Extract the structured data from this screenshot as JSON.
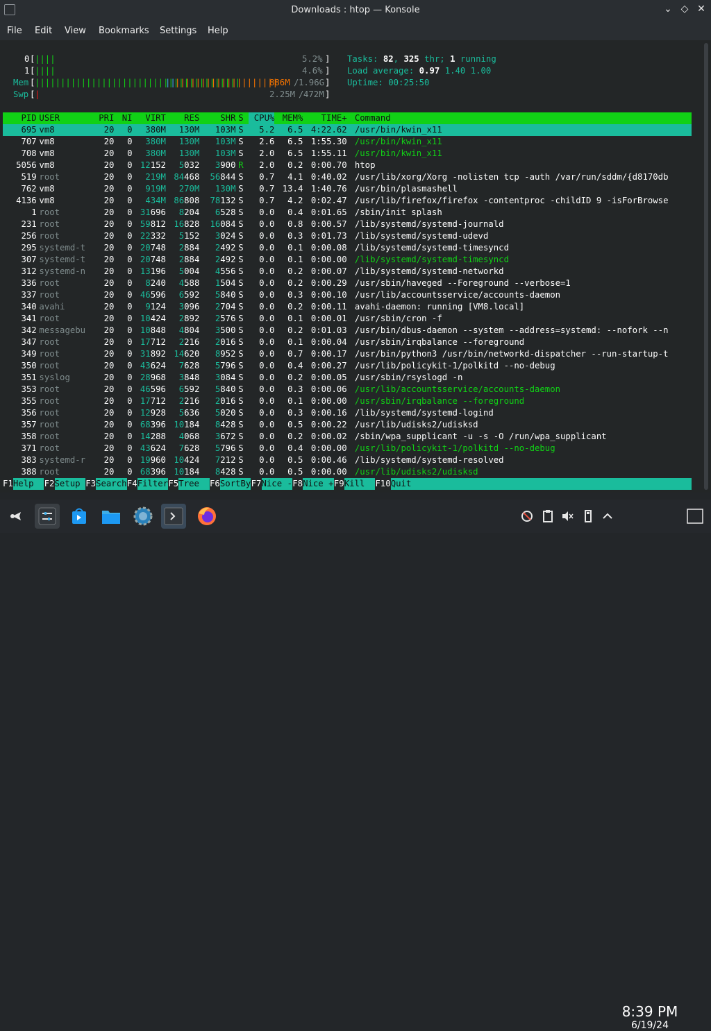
{
  "window": {
    "title": "Downloads : htop — Konsole"
  },
  "menu": [
    "File",
    "Edit",
    "View",
    "Bookmarks",
    "Settings",
    "Help"
  ],
  "meters": {
    "cpu0": {
      "label": "0",
      "bar": "||||",
      "value": "5.2%"
    },
    "cpu1": {
      "label": "1",
      "bar": "||||",
      "value": "4.6%"
    },
    "mem": {
      "label": "Mem",
      "bar_green": "||||||||||||||||||||||||||||||||||||||||",
      "bar_blue": "||",
      "bar_orange": "||||||||||||||||||||",
      "used": "886M",
      "total": "1.96G"
    },
    "swp": {
      "label": "Swp",
      "bar": "|",
      "used": "2.25M",
      "total": "472M"
    }
  },
  "stats": {
    "tasks": "82",
    "thr": "325",
    "running": "1",
    "load1": "0.97",
    "load5": "1.40",
    "load15": "1.00",
    "uptime": "00:25:50"
  },
  "table": {
    "columns": [
      "PID",
      "USER",
      "PRI",
      "NI",
      "VIRT",
      "RES",
      "SHR",
      "S",
      "CPU%",
      "MEM%",
      "TIME+",
      "Command"
    ],
    "sort_column": "CPU%",
    "rows": [
      {
        "pid": "695",
        "user": "vm8",
        "pri": "20",
        "ni": "0",
        "virt": "380M",
        "res": "130M",
        "shr": "103M",
        "s": "S",
        "cpu": "5.2",
        "mem": "6.5",
        "time": "4:22.62",
        "cmd": "/usr/bin/kwin_x11",
        "selected": true
      },
      {
        "pid": "707",
        "user": "vm8",
        "pri": "20",
        "ni": "0",
        "virt": "380M",
        "res": "130M",
        "shr": "103M",
        "s": "S",
        "cpu": "2.6",
        "mem": "6.5",
        "time": "1:55.30",
        "cmd": "/usr/bin/kwin_x11",
        "thread": true
      },
      {
        "pid": "708",
        "user": "vm8",
        "pri": "20",
        "ni": "0",
        "virt": "380M",
        "res": "130M",
        "shr": "103M",
        "s": "S",
        "cpu": "2.0",
        "mem": "6.5",
        "time": "1:55.11",
        "cmd": "/usr/bin/kwin_x11",
        "thread": true
      },
      {
        "pid": "5056",
        "user": "vm8",
        "pri": "20",
        "ni": "0",
        "virt": "12152",
        "res": "5032",
        "shr": "3900",
        "s": "R",
        "cpu": "2.0",
        "mem": "0.2",
        "time": "0:00.70",
        "cmd": "htop"
      },
      {
        "pid": "519",
        "user": "root",
        "pri": "20",
        "ni": "0",
        "virt": "219M",
        "res": "84468",
        "shr": "56844",
        "s": "S",
        "cpu": "0.7",
        "mem": "4.1",
        "time": "0:40.02",
        "cmd": "/usr/lib/xorg/Xorg -nolisten tcp -auth /var/run/sddm/{d8170db"
      },
      {
        "pid": "762",
        "user": "vm8",
        "pri": "20",
        "ni": "0",
        "virt": "919M",
        "res": "270M",
        "shr": "130M",
        "s": "S",
        "cpu": "0.7",
        "mem": "13.4",
        "time": "1:40.76",
        "cmd": "/usr/bin/plasmashell"
      },
      {
        "pid": "4136",
        "user": "vm8",
        "pri": "20",
        "ni": "0",
        "virt": "434M",
        "res": "86808",
        "shr": "78132",
        "s": "S",
        "cpu": "0.7",
        "mem": "4.2",
        "time": "0:02.47",
        "cmd": "/usr/lib/firefox/firefox -contentproc -childID 9 -isForBrowse"
      },
      {
        "pid": "1",
        "user": "root",
        "pri": "20",
        "ni": "0",
        "virt": "31696",
        "res": "8204",
        "shr": "6528",
        "s": "S",
        "cpu": "0.0",
        "mem": "0.4",
        "time": "0:01.65",
        "cmd": "/sbin/init splash"
      },
      {
        "pid": "231",
        "user": "root",
        "pri": "20",
        "ni": "0",
        "virt": "59812",
        "res": "16828",
        "shr": "16084",
        "s": "S",
        "cpu": "0.0",
        "mem": "0.8",
        "time": "0:00.57",
        "cmd": "/lib/systemd/systemd-journald"
      },
      {
        "pid": "256",
        "user": "root",
        "pri": "20",
        "ni": "0",
        "virt": "22332",
        "res": "5152",
        "shr": "3024",
        "s": "S",
        "cpu": "0.0",
        "mem": "0.3",
        "time": "0:01.73",
        "cmd": "/lib/systemd/systemd-udevd"
      },
      {
        "pid": "295",
        "user": "systemd-t",
        "pri": "20",
        "ni": "0",
        "virt": "20748",
        "res": "2884",
        "shr": "2492",
        "s": "S",
        "cpu": "0.0",
        "mem": "0.1",
        "time": "0:00.08",
        "cmd": "/lib/systemd/systemd-timesyncd"
      },
      {
        "pid": "307",
        "user": "systemd-t",
        "pri": "20",
        "ni": "0",
        "virt": "20748",
        "res": "2884",
        "shr": "2492",
        "s": "S",
        "cpu": "0.0",
        "mem": "0.1",
        "time": "0:00.00",
        "cmd": "/lib/systemd/systemd-timesyncd",
        "thread": true
      },
      {
        "pid": "312",
        "user": "systemd-n",
        "pri": "20",
        "ni": "0",
        "virt": "13196",
        "res": "5004",
        "shr": "4556",
        "s": "S",
        "cpu": "0.0",
        "mem": "0.2",
        "time": "0:00.07",
        "cmd": "/lib/systemd/systemd-networkd"
      },
      {
        "pid": "336",
        "user": "root",
        "pri": "20",
        "ni": "0",
        "virt": "8240",
        "res": "4588",
        "shr": "1504",
        "s": "S",
        "cpu": "0.0",
        "mem": "0.2",
        "time": "0:00.29",
        "cmd": "/usr/sbin/haveged --Foreground --verbose=1"
      },
      {
        "pid": "337",
        "user": "root",
        "pri": "20",
        "ni": "0",
        "virt": "46596",
        "res": "6592",
        "shr": "5840",
        "s": "S",
        "cpu": "0.0",
        "mem": "0.3",
        "time": "0:00.10",
        "cmd": "/usr/lib/accountsservice/accounts-daemon"
      },
      {
        "pid": "340",
        "user": "avahi",
        "pri": "20",
        "ni": "0",
        "virt": "9124",
        "res": "3096",
        "shr": "2704",
        "s": "S",
        "cpu": "0.0",
        "mem": "0.2",
        "time": "0:00.11",
        "cmd": "avahi-daemon: running [VM8.local]"
      },
      {
        "pid": "341",
        "user": "root",
        "pri": "20",
        "ni": "0",
        "virt": "10424",
        "res": "2892",
        "shr": "2576",
        "s": "S",
        "cpu": "0.0",
        "mem": "0.1",
        "time": "0:00.01",
        "cmd": "/usr/sbin/cron -f"
      },
      {
        "pid": "342",
        "user": "messagebu",
        "pri": "20",
        "ni": "0",
        "virt": "10848",
        "res": "4804",
        "shr": "3500",
        "s": "S",
        "cpu": "0.0",
        "mem": "0.2",
        "time": "0:01.03",
        "cmd": "/usr/bin/dbus-daemon --system --address=systemd: --nofork --n"
      },
      {
        "pid": "347",
        "user": "root",
        "pri": "20",
        "ni": "0",
        "virt": "17712",
        "res": "2216",
        "shr": "2016",
        "s": "S",
        "cpu": "0.0",
        "mem": "0.1",
        "time": "0:00.04",
        "cmd": "/usr/sbin/irqbalance --foreground"
      },
      {
        "pid": "349",
        "user": "root",
        "pri": "20",
        "ni": "0",
        "virt": "31892",
        "res": "14620",
        "shr": "8952",
        "s": "S",
        "cpu": "0.0",
        "mem": "0.7",
        "time": "0:00.17",
        "cmd": "/usr/bin/python3 /usr/bin/networkd-dispatcher --run-startup-t"
      },
      {
        "pid": "350",
        "user": "root",
        "pri": "20",
        "ni": "0",
        "virt": "43624",
        "res": "7628",
        "shr": "5796",
        "s": "S",
        "cpu": "0.0",
        "mem": "0.4",
        "time": "0:00.27",
        "cmd": "/usr/lib/policykit-1/polkitd --no-debug"
      },
      {
        "pid": "351",
        "user": "syslog",
        "pri": "20",
        "ni": "0",
        "virt": "28968",
        "res": "3848",
        "shr": "3084",
        "s": "S",
        "cpu": "0.0",
        "mem": "0.2",
        "time": "0:00.05",
        "cmd": "/usr/sbin/rsyslogd -n"
      },
      {
        "pid": "353",
        "user": "root",
        "pri": "20",
        "ni": "0",
        "virt": "46596",
        "res": "6592",
        "shr": "5840",
        "s": "S",
        "cpu": "0.0",
        "mem": "0.3",
        "time": "0:00.06",
        "cmd": "/usr/lib/accountsservice/accounts-daemon",
        "thread": true
      },
      {
        "pid": "355",
        "user": "root",
        "pri": "20",
        "ni": "0",
        "virt": "17712",
        "res": "2216",
        "shr": "2016",
        "s": "S",
        "cpu": "0.0",
        "mem": "0.1",
        "time": "0:00.00",
        "cmd": "/usr/sbin/irqbalance --foreground",
        "thread": true
      },
      {
        "pid": "356",
        "user": "root",
        "pri": "20",
        "ni": "0",
        "virt": "12928",
        "res": "5636",
        "shr": "5020",
        "s": "S",
        "cpu": "0.0",
        "mem": "0.3",
        "time": "0:00.16",
        "cmd": "/lib/systemd/systemd-logind"
      },
      {
        "pid": "357",
        "user": "root",
        "pri": "20",
        "ni": "0",
        "virt": "68396",
        "res": "10184",
        "shr": "8428",
        "s": "S",
        "cpu": "0.0",
        "mem": "0.5",
        "time": "0:00.22",
        "cmd": "/usr/lib/udisks2/udisksd"
      },
      {
        "pid": "358",
        "user": "root",
        "pri": "20",
        "ni": "0",
        "virt": "14288",
        "res": "4068",
        "shr": "3672",
        "s": "S",
        "cpu": "0.0",
        "mem": "0.2",
        "time": "0:00.02",
        "cmd": "/sbin/wpa_supplicant -u -s -O /run/wpa_supplicant"
      },
      {
        "pid": "371",
        "user": "root",
        "pri": "20",
        "ni": "0",
        "virt": "43624",
        "res": "7628",
        "shr": "5796",
        "s": "S",
        "cpu": "0.0",
        "mem": "0.4",
        "time": "0:00.00",
        "cmd": "/usr/lib/policykit-1/polkitd --no-debug",
        "thread": true
      },
      {
        "pid": "383",
        "user": "systemd-r",
        "pri": "20",
        "ni": "0",
        "virt": "19960",
        "res": "10424",
        "shr": "7212",
        "s": "S",
        "cpu": "0.0",
        "mem": "0.5",
        "time": "0:00.46",
        "cmd": "/lib/systemd/systemd-resolved"
      },
      {
        "pid": "388",
        "user": "root",
        "pri": "20",
        "ni": "0",
        "virt": "68396",
        "res": "10184",
        "shr": "8428",
        "s": "S",
        "cpu": "0.0",
        "mem": "0.5",
        "time": "0:00.00",
        "cmd": "/usr/lib/udisks2/udisksd",
        "thread": true
      }
    ]
  },
  "fkeys": [
    {
      "key": "F1",
      "label": "Help  "
    },
    {
      "key": "F2",
      "label": "Setup "
    },
    {
      "key": "F3",
      "label": "Search"
    },
    {
      "key": "F4",
      "label": "Filter"
    },
    {
      "key": "F5",
      "label": "Tree  "
    },
    {
      "key": "F6",
      "label": "SortBy"
    },
    {
      "key": "F7",
      "label": "Nice -"
    },
    {
      "key": "F8",
      "label": "Nice +"
    },
    {
      "key": "F9",
      "label": "Kill  "
    },
    {
      "key": "F10",
      "label": "Quit"
    }
  ],
  "taskbar": {
    "apps": [
      {
        "name": "application-launcher-icon"
      },
      {
        "name": "system-settings-app-icon"
      },
      {
        "name": "discover-store-icon"
      },
      {
        "name": "dolphin-files-icon"
      },
      {
        "name": "system-preferences-icon"
      },
      {
        "name": "konsole-icon"
      },
      {
        "name": "firefox-icon"
      }
    ],
    "tray": [
      "network-icon",
      "clipboard-icon",
      "volume-muted-icon",
      "usb-device-icon",
      "tray-expand-icon",
      "show-desktop-icon"
    ],
    "time": "8:39 PM",
    "date": "6/19/24"
  },
  "colors": {
    "header_green": "#11d116",
    "selection_cyan": "#1abc9c",
    "terminal_bg": "#232627",
    "mem_orange": "#f67400"
  }
}
